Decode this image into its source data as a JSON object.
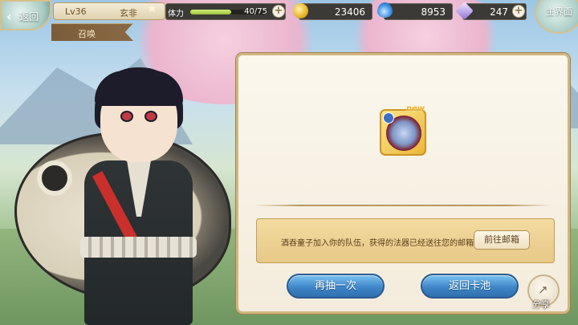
{
  "hud": {
    "back_label": "返回",
    "level": "Lv36",
    "player_name": "玄非",
    "screen_title": "召唤",
    "stamina_label": "体力",
    "stamina_value": "40/75",
    "stamina_fraction": 0.533,
    "gold": "23406",
    "jade": "8953",
    "crystal": "247",
    "main_label": "主界面"
  },
  "result": {
    "item_badge": "new",
    "message": "酒吞童子加入你的队伍，获得的法器已经送往您的邮箱！",
    "mail_button": "前往邮箱",
    "draw_again": "再抽一次",
    "back_to_pool": "返回卡池",
    "share": "分享"
  },
  "colors": {
    "accent_blue": "#3e86c9",
    "panel_bg": "#fbf7ed",
    "gold": "#e9b739",
    "stamina_fill": "#9ec33a"
  },
  "icons": {
    "back": "chevron-left-icon",
    "star": "star-icon",
    "gold": "gold-coin-icon",
    "jade": "blue-flame-icon",
    "crystal": "crystal-icon",
    "share": "share-icon",
    "add": "plus-icon"
  }
}
